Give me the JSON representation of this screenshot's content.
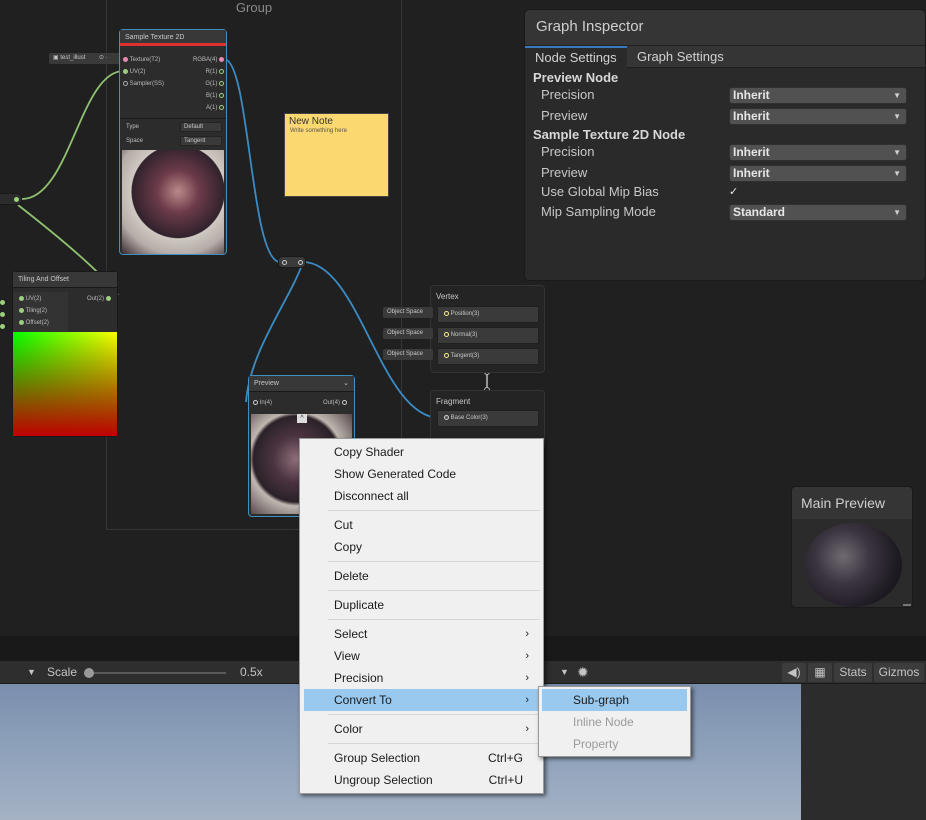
{
  "canvas": {
    "group_title": "Group",
    "property_pill": "test_illust",
    "sample_texture": {
      "title": "Sample Texture 2D",
      "inputs": [
        "Texture(T2)",
        "UV(2)",
        "Sampler(SS)"
      ],
      "outputs": [
        "RGBA(4)",
        "R(1)",
        "G(1)",
        "B(1)",
        "A(1)"
      ],
      "type_label": "Type",
      "type_value": "Default",
      "space_label": "Space",
      "space_value": "Tangent"
    },
    "note": {
      "title": "New Note",
      "body": "Write something here"
    },
    "tiling": {
      "title": "Tiling And Offset",
      "inputs": [
        "UV(2)",
        "Tiling(2)",
        "Offset(2)"
      ],
      "output": "Out(2)"
    },
    "preview_node": {
      "title": "Preview",
      "input": "In(4)",
      "output": "Out(4)"
    },
    "vertex": {
      "title": "Vertex",
      "slots": [
        "Position(3)",
        "Normal(3)",
        "Tangent(3)"
      ],
      "space_label": "Object Space"
    },
    "fragment": {
      "title": "Fragment",
      "slots": [
        "Base Color(3)"
      ]
    }
  },
  "inspector": {
    "title": "Graph Inspector",
    "tabs": [
      "Node Settings",
      "Graph Settings"
    ],
    "section1": "Preview Node",
    "section2": "Sample Texture 2D Node",
    "rows": {
      "precision": "Precision",
      "preview": "Preview",
      "global_mip": "Use Global Mip Bias",
      "mip_mode": "Mip Sampling Mode"
    },
    "values": {
      "inherit": "Inherit",
      "standard": "Standard",
      "check": "✓"
    }
  },
  "main_preview": {
    "title": "Main Preview"
  },
  "toolbar": {
    "scale_label": "Scale",
    "scale_value": "0.5x",
    "stats": "Stats",
    "gizmos": "Gizmos"
  },
  "context_menu": {
    "items": [
      {
        "label": "Copy Shader"
      },
      {
        "label": "Show Generated Code"
      },
      {
        "label": "Disconnect all"
      },
      {
        "label": "Cut"
      },
      {
        "label": "Copy"
      },
      {
        "label": "Delete"
      },
      {
        "label": "Duplicate"
      },
      {
        "label": "Select"
      },
      {
        "label": "View"
      },
      {
        "label": "Precision"
      },
      {
        "label": "Convert To"
      },
      {
        "label": "Color"
      },
      {
        "label": "Group Selection",
        "shortcut": "Ctrl+G"
      },
      {
        "label": "Ungroup Selection",
        "shortcut": "Ctrl+U"
      }
    ],
    "arrow": "›"
  },
  "submenu": {
    "items": [
      "Sub-graph",
      "Inline Node",
      "Property"
    ]
  },
  "colors": {
    "selection": "#3f8fc0",
    "edge_green": "#8fc26f",
    "edge_blue": "#3a8cc4",
    "menu_highlight": "#99c9ef",
    "note_yellow": "#fcd870"
  }
}
